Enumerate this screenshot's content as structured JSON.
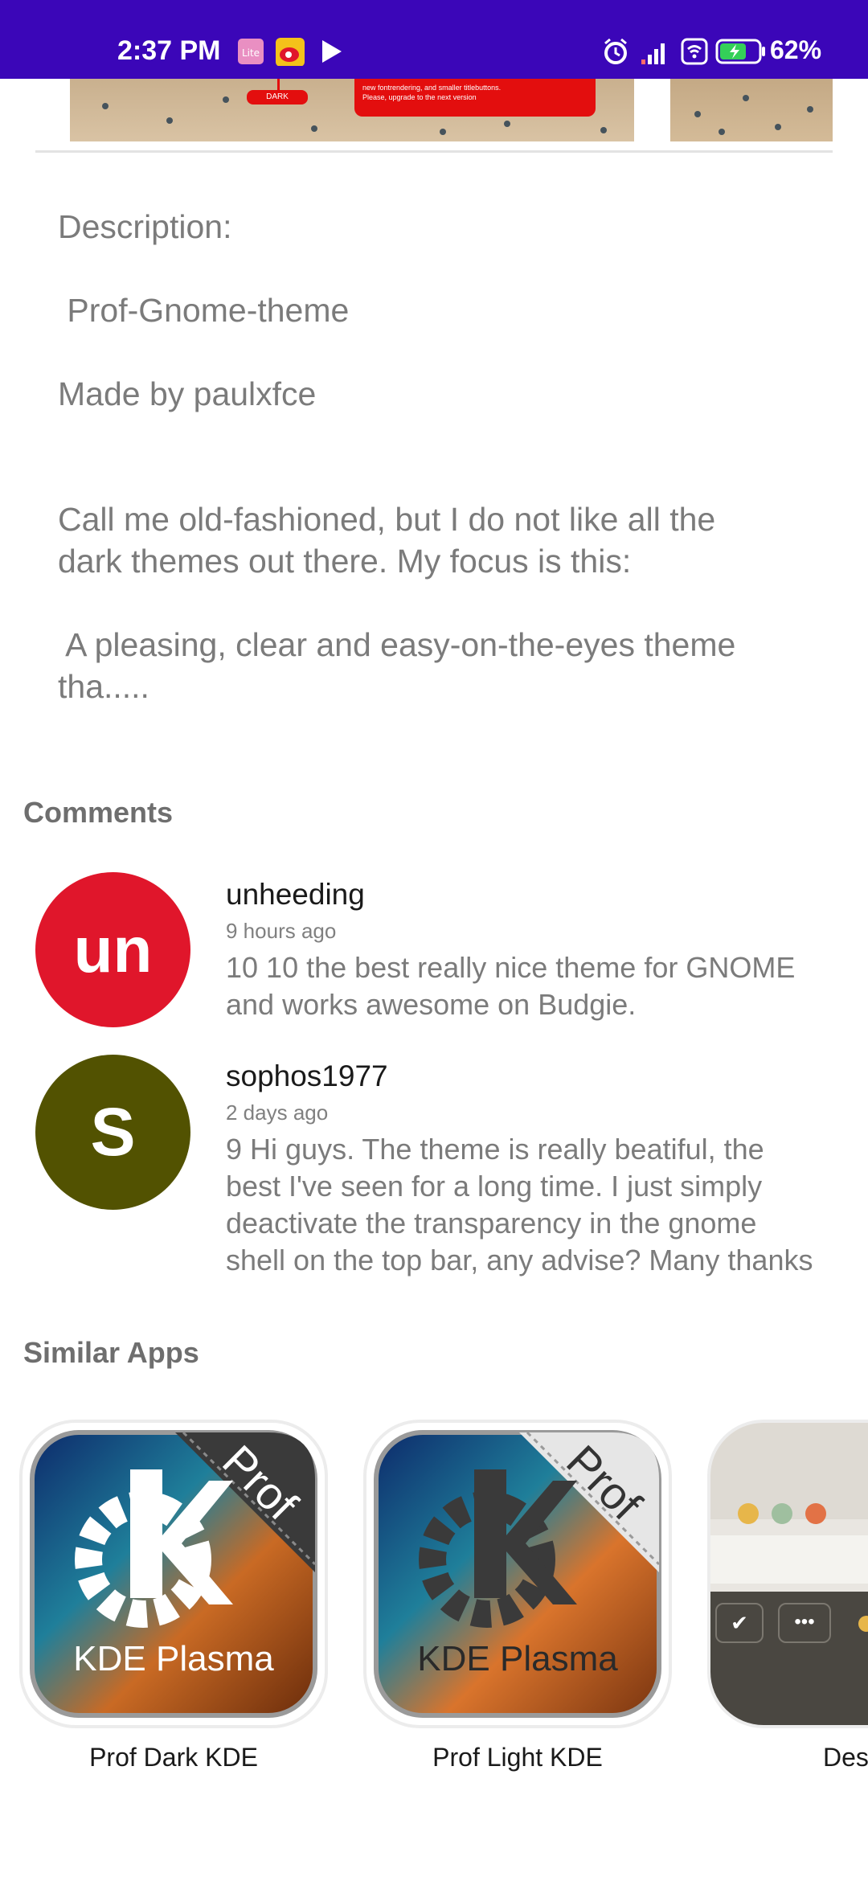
{
  "status_bar": {
    "time": "2:37 PM",
    "battery": "62%",
    "background": "#3b06b8",
    "icons": [
      "lite-app-icon",
      "weibo-icon",
      "play-store-icon",
      "alarm-icon",
      "signal-icon",
      "wifi-icon",
      "battery-icon"
    ]
  },
  "screenshots": {
    "pill_label": "DARK",
    "red_box_lines": [
      "new fontrendering, and smaller titlebuttons.",
      "Please, upgrade to the next version"
    ]
  },
  "description": {
    "heading": "Description:",
    "name": " Prof-Gnome-theme",
    "author": "Made by paulxfce",
    "para1_line1": "Call me old-fashioned, but I do not like all the",
    "para1_line2": "dark themes out there. My focus is this:",
    "para2_line1": " A pleasing, clear and easy-on-the-eyes theme",
    "para2_line2": "tha....."
  },
  "comments_section": {
    "title": "Comments",
    "items": [
      {
        "initials": "un",
        "avatar_color": "#e0162b",
        "user": "unheeding",
        "time": "9 hours ago",
        "lines": [
          "10 10 the best really nice theme for GNOME",
          "and works awesome on Budgie."
        ]
      },
      {
        "initials": "S",
        "avatar_color": "#525201",
        "user": "sophos1977",
        "time": "2 days ago",
        "lines": [
          "9 Hi guys. The theme is really beatiful, the",
          "best I've seen for a long time. I just simply",
          "deactivate the transparency in the gnome",
          "shell on the top bar, any advise? Many thanks"
        ]
      }
    ]
  },
  "similar_apps": {
    "title": "Similar Apps",
    "items": [
      {
        "name": "Prof Dark KDE",
        "badge": "Prof",
        "logo_text": "KDE Plasma"
      },
      {
        "name": "Prof Light KDE",
        "badge": "Prof",
        "logo_text": "KDE Plasma"
      },
      {
        "name": "Des"
      }
    ]
  }
}
